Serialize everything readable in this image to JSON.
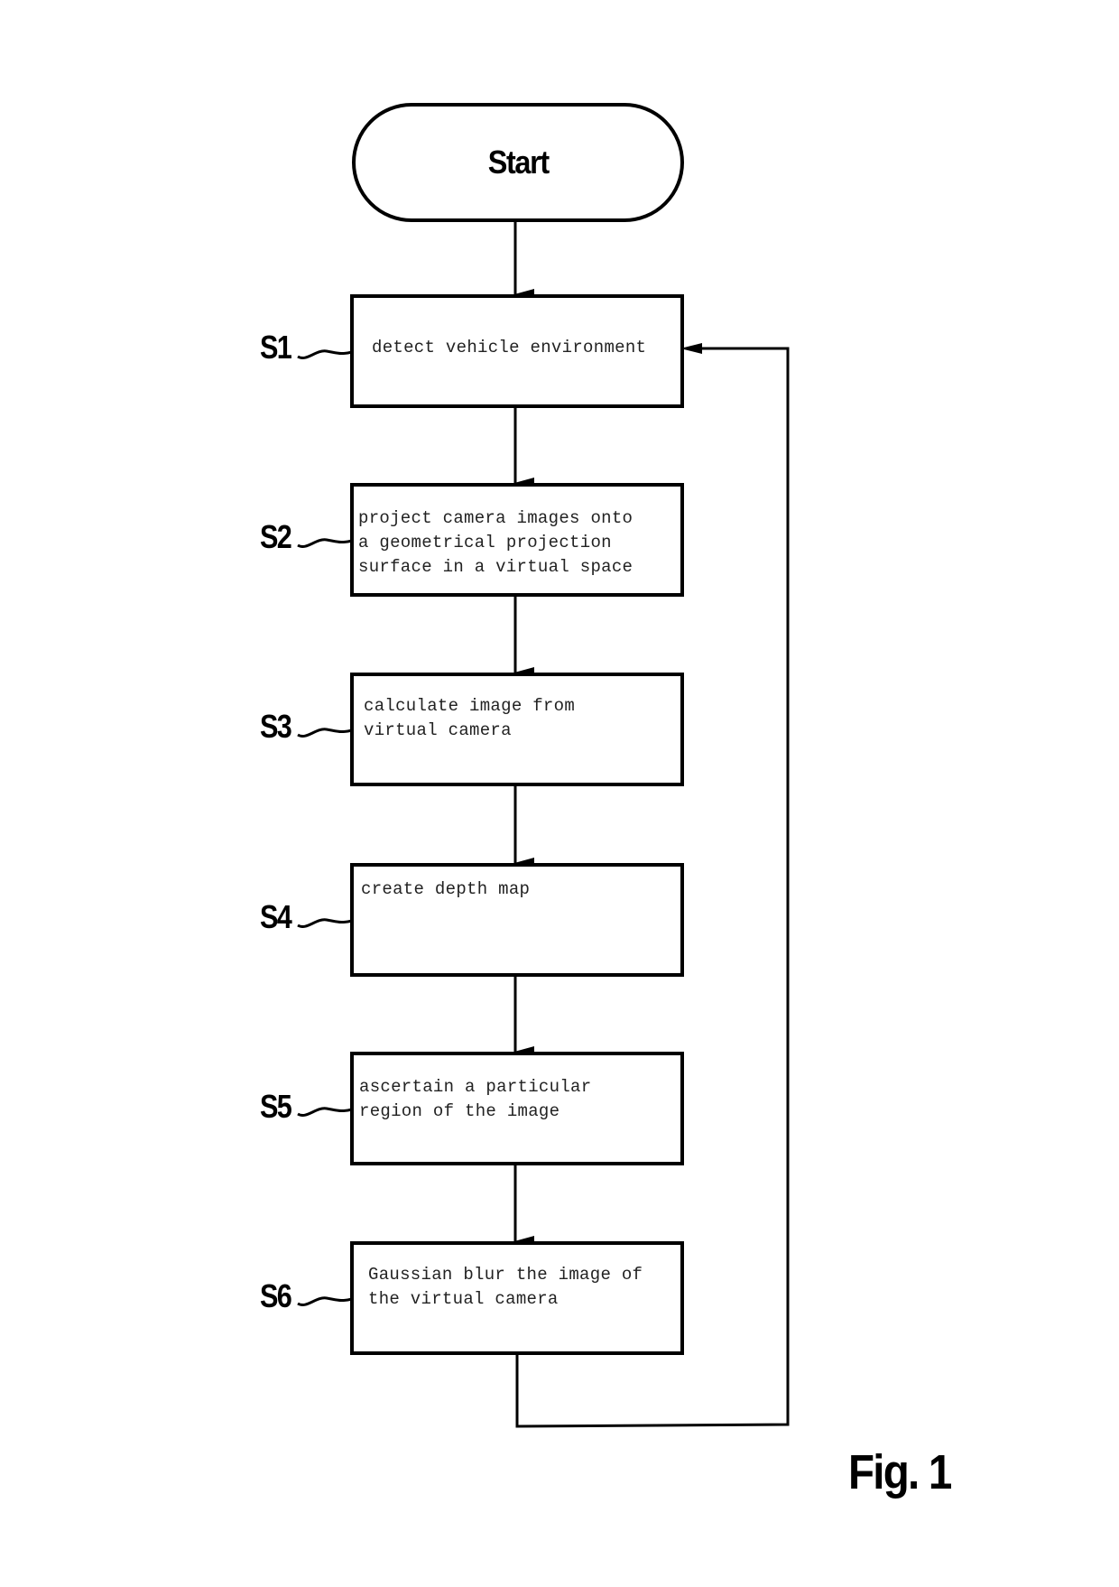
{
  "figure": {
    "label": "Fig. 1",
    "start": {
      "label": "Start"
    },
    "steps": [
      {
        "id": "S1",
        "text": "detect vehicle environment"
      },
      {
        "id": "S2",
        "text": "project camera images onto\na geometrical projection\nsurface in a virtual space"
      },
      {
        "id": "S3",
        "text": "calculate image from\nvirtual camera"
      },
      {
        "id": "S4",
        "text": "create depth map"
      },
      {
        "id": "S5",
        "text": "ascertain a particular\nregion of the image"
      },
      {
        "id": "S6",
        "text": "Gaussian blur the image of\nthe virtual camera"
      }
    ],
    "edges": [
      {
        "from": "Start",
        "to": "S1"
      },
      {
        "from": "S1",
        "to": "S2"
      },
      {
        "from": "S2",
        "to": "S3"
      },
      {
        "from": "S3",
        "to": "S4"
      },
      {
        "from": "S4",
        "to": "S5"
      },
      {
        "from": "S5",
        "to": "S6"
      },
      {
        "from": "S6",
        "to": "S1",
        "type": "loop-back"
      }
    ]
  }
}
